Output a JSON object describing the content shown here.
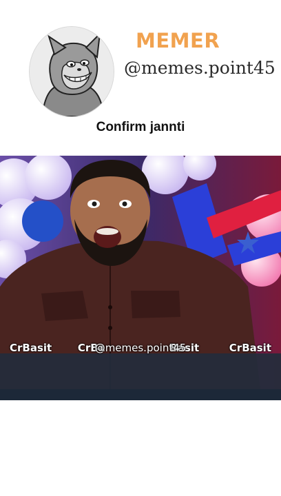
{
  "header": {
    "brand": "MEMER",
    "handle": "@memes.point45",
    "avatar_icon": "cartoon-cat-avatar-icon"
  },
  "caption": "Confirm jannti",
  "video": {
    "watermarks": [
      "CrBasit",
      "CrBa",
      "Basit",
      "CrBasit"
    ],
    "center_watermark": "@memes.point45"
  },
  "colors": {
    "brand": "#f1a24f",
    "background": "#ffffff"
  }
}
